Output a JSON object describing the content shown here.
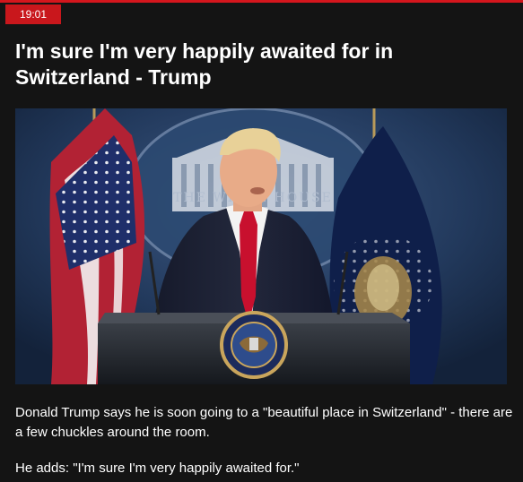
{
  "entry": {
    "time": "19:01",
    "headline": "I'm sure I'm very happily awaited for in Switzerland - Trump",
    "paragraphs": [
      "Donald Trump says he is soon going to a \"beautiful place in Switzerland\" - there are a few chuckles around the room.",
      "He adds: \"I'm sure I'm very happily awaited for.\""
    ],
    "image": {
      "backdrop_text": "THE WHITE HOUSE"
    }
  },
  "colors": {
    "accent": "#d4161d",
    "background": "#141414",
    "text": "#ffffff"
  }
}
